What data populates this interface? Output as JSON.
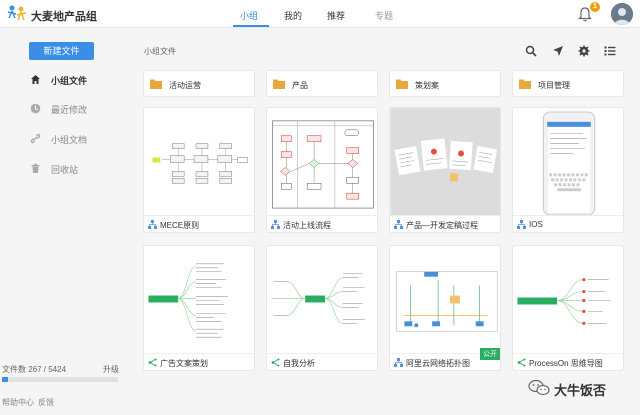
{
  "header": {
    "brand": "大麦地产品组",
    "nav": [
      "小组",
      "我的",
      "推荐",
      "专题"
    ],
    "notification_count": "1"
  },
  "sidebar": {
    "new_button": "新建文件",
    "items": [
      "小组文件",
      "最近修改",
      "小组文档",
      "回收站"
    ],
    "storage_label": "文件数 267 / 5424",
    "storage_fraction": 0.049,
    "upgrade": "升级",
    "help": "帮助中心",
    "feedback": "反馈"
  },
  "main": {
    "breadcrumb": "小组文件",
    "folders": [
      "活动运营",
      "产品",
      "策划案",
      "项目管理"
    ],
    "files": [
      {
        "title": "MECE原则",
        "icon": "diagram-icon"
      },
      {
        "title": "活动上线流程",
        "icon": "diagram-icon"
      },
      {
        "title": "产品—开发定稿过程",
        "icon": "diagram-icon"
      },
      {
        "title": "IOS",
        "icon": "diagram-icon"
      },
      {
        "title": "广告文案策划",
        "icon": "mindmap-icon"
      },
      {
        "title": "自我分析",
        "icon": "mindmap-icon"
      },
      {
        "title": "阿里云网络拓扑图",
        "icon": "diagram-icon",
        "tag": "公开"
      },
      {
        "title": "ProcessOn 思维导图",
        "icon": "mindmap-icon"
      }
    ]
  },
  "watermark": "大牛饭否",
  "colors": {
    "accent": "#3a8ee6",
    "folder": "#e8a93a",
    "public": "#27ae60"
  }
}
